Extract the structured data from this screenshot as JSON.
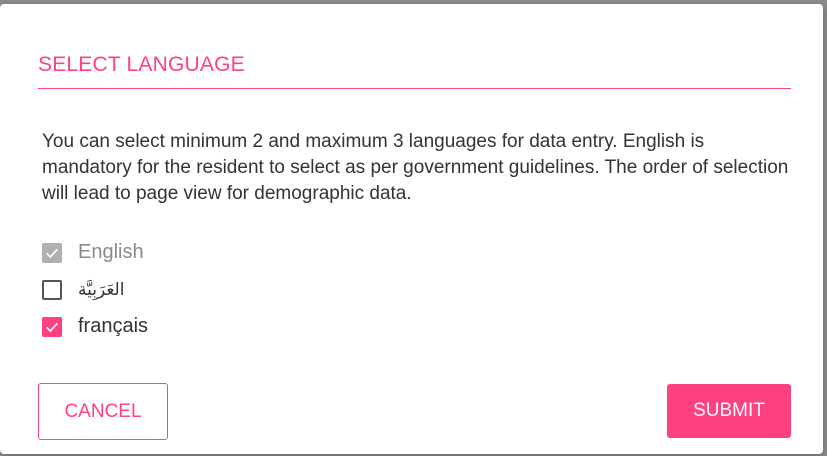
{
  "dialog": {
    "title": "SELECT LANGUAGE",
    "description": "You can select minimum 2 and maximum 3 languages for data entry. English is mandatory for the resident to select as per government guidelines. The order of selection will lead to page view for demographic data.",
    "languages": [
      {
        "label": "English",
        "checked": true,
        "disabled": true
      },
      {
        "label": "العَرَبِيَّة",
        "checked": false,
        "disabled": false
      },
      {
        "label": "français",
        "checked": true,
        "disabled": false
      }
    ],
    "cancel_label": "CANCEL",
    "submit_label": "SUBMIT"
  },
  "colors": {
    "accent": "#ff4081",
    "disabled": "#b0b0b0",
    "text": "#333333"
  },
  "icons": {
    "check": "check-icon"
  }
}
